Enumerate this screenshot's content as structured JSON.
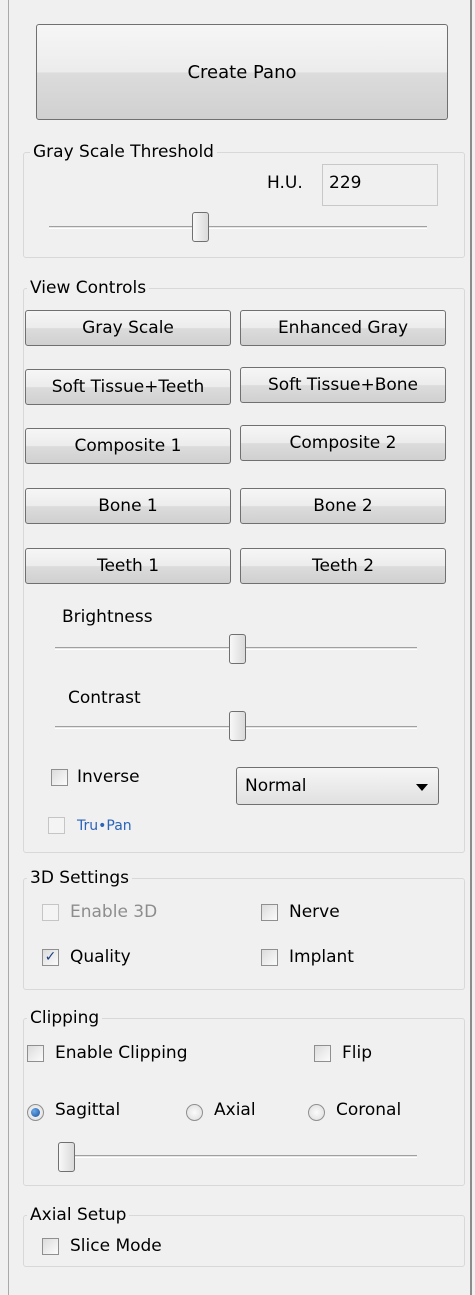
{
  "create_pano": {
    "label": "Create Pano"
  },
  "threshold": {
    "title": "Gray Scale Threshold",
    "hu_label": "H.U.",
    "hu_value": "229",
    "slider_value": 0.48
  },
  "view_controls": {
    "title": "View Controls",
    "buttons": [
      "Gray Scale",
      "Enhanced Gray",
      "Soft Tissue+Teeth",
      "Soft Tissue+Bone",
      "Composite 1",
      "Composite 2",
      "Bone 1",
      "Bone 2",
      "Teeth 1",
      "Teeth 2"
    ],
    "brightness_label": "Brightness",
    "brightness_value": 0.5,
    "contrast_label": "Contrast",
    "contrast_value": 0.5,
    "inverse_label": "Inverse",
    "inverse_checked": false,
    "mode_select": "Normal",
    "trupan_label": "Tru•Pan",
    "trupan_checked": false
  },
  "settings_3d": {
    "title": "3D Settings",
    "enable_3d": "Enable 3D",
    "nerve": "Nerve",
    "quality": "Quality",
    "quality_checked": true,
    "implant": "Implant"
  },
  "clipping": {
    "title": "Clipping",
    "enable_clipping": "Enable Clipping",
    "flip": "Flip",
    "sagittal": "Sagittal",
    "axial": "Axial",
    "coronal": "Coronal",
    "selected": "Sagittal",
    "slider_value": 0.0
  },
  "axial_setup": {
    "title": "Axial Setup",
    "slice_mode": "Slice Mode"
  },
  "colors": {
    "panel_bg": "#f0f0f0",
    "accent_blue": "#1c3e86",
    "logo_blue": "#2a63b8"
  }
}
